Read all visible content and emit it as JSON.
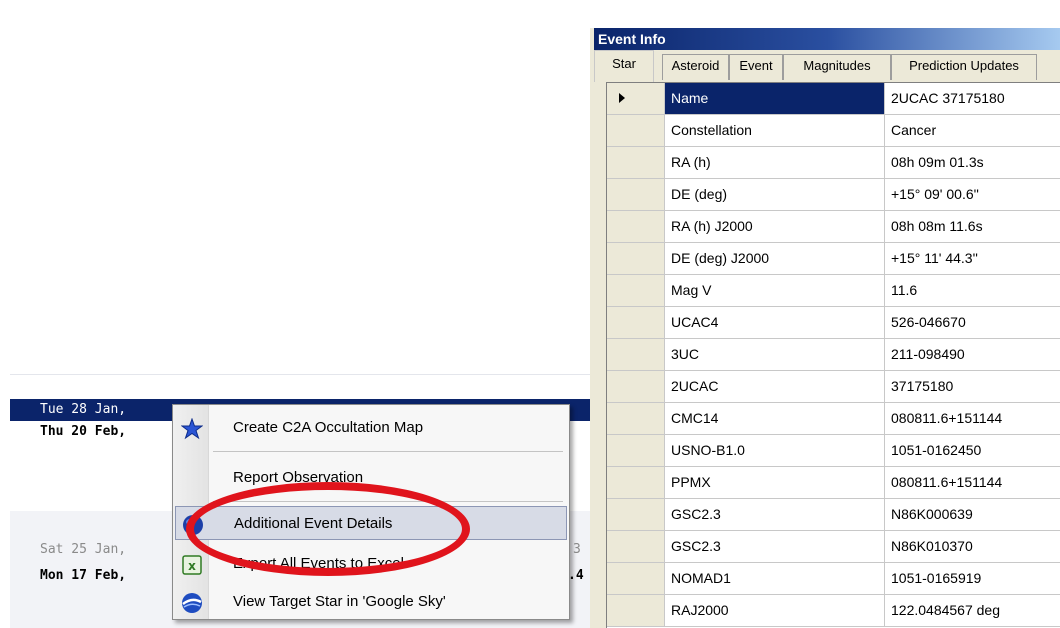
{
  "list": {
    "rows": [
      {
        "text": "Tue 28 Jan,",
        "style": "selected"
      },
      {
        "text": "Thu 20 Feb,",
        "style": "bold"
      },
      {
        "text": "Sat 25 Jan,",
        "style": "dim"
      },
      {
        "text": "Mon 17 Feb,",
        "style": "bold"
      }
    ],
    "fragments": {
      "a": "3",
      "b": ".4"
    }
  },
  "context_menu": {
    "items": [
      {
        "label": "Create C2A Occultation Map",
        "icon": "c2a-star-icon"
      },
      {
        "label": "Report Observation",
        "icon": ""
      },
      {
        "label": "Additional Event Details",
        "icon": "blue-globe-icon"
      },
      {
        "label": "Export All Events to Excel",
        "icon": "excel-icon"
      },
      {
        "label": "View Target Star in 'Google Sky'",
        "icon": "google-sky-icon"
      }
    ],
    "highlighted_index": 2,
    "annotation_color": "#e0141c"
  },
  "event_info": {
    "title": "Event Info",
    "tabs": [
      "Star",
      "Asteroid",
      "Event",
      "Magnitudes",
      "Prediction Updates"
    ],
    "active_tab": "Star",
    "rows": [
      {
        "name": "Name",
        "value": "2UCAC 37175180"
      },
      {
        "name": "Constellation",
        "value": "Cancer"
      },
      {
        "name": "RA (h)",
        "value": "08h 09m 01.3s"
      },
      {
        "name": "DE (deg)",
        "value": "+15° 09' 00.6''"
      },
      {
        "name": "RA (h) J2000",
        "value": "08h 08m 11.6s"
      },
      {
        "name": "DE (deg) J2000",
        "value": "+15° 11' 44.3''"
      },
      {
        "name": "Mag V",
        "value": "11.6"
      },
      {
        "name": "UCAC4",
        "value": "526-046670"
      },
      {
        "name": "3UC",
        "value": "211-098490"
      },
      {
        "name": "2UCAC",
        "value": "37175180"
      },
      {
        "name": "CMC14",
        "value": "080811.6+151144"
      },
      {
        "name": "USNO-B1.0",
        "value": "1051-0162450"
      },
      {
        "name": "PPMX",
        "value": "080811.6+151144"
      },
      {
        "name": "GSC2.3",
        "value": "N86K000639"
      },
      {
        "name": "GSC2.3",
        "value": "N86K010370"
      },
      {
        "name": "NOMAD1",
        "value": "1051-0165919"
      },
      {
        "name": "RAJ2000",
        "value": "122.0484567 deg"
      }
    ],
    "colors": {
      "title_start": "#0a246a",
      "title_end": "#a6caf0",
      "selection": "#0a246a"
    }
  }
}
